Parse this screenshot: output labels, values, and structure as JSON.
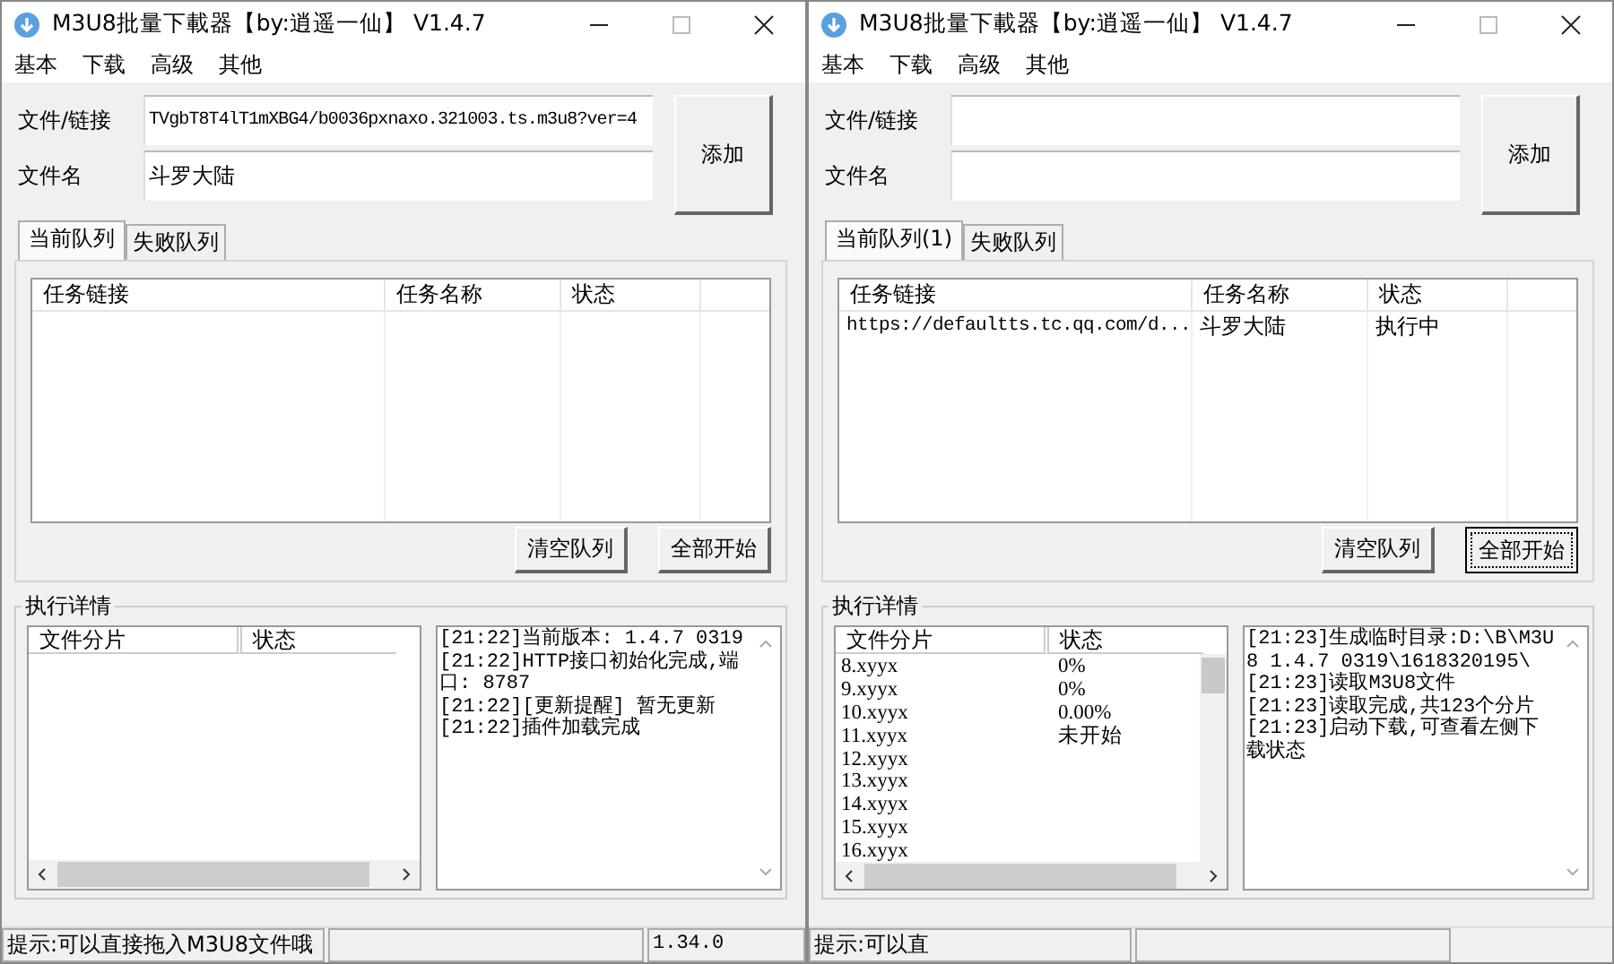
{
  "windows": [
    {
      "title": "M3U8批量下載器【by:逍遥一仙】 V1.4.7",
      "menu": [
        "基本",
        "下载",
        "高级",
        "其他"
      ],
      "fields": [
        {
          "label": "文件/链接",
          "value": "TVgbT8T4lT1mXBG4/b0036pxnaxo.321003.ts.m3u8?ver=4"
        },
        {
          "label": "文件名",
          "value": "斗罗大陆"
        }
      ],
      "add_button": "添加",
      "tabs": [
        {
          "label": "当前队列",
          "selected": true
        },
        {
          "label": "失败队列",
          "selected": false
        }
      ],
      "tasks": {
        "columns": [
          "任务链接",
          "任务名称",
          "状态"
        ]
      },
      "queue_buttons": [
        {
          "label": "清空队列",
          "focused": false
        },
        {
          "label": "全部开始",
          "focused": false
        }
      ],
      "details": {
        "title": "执行详情",
        "columns": [
          "文件分片",
          "状态"
        ],
        "log": [
          "[21:22]当前版本: 1.4.7 0319",
          "[21:22]HTTP接口初始化完成,端口: 8787",
          "[21:22][更新提醒] 暂无更新",
          "[21:22]插件加载完成"
        ]
      },
      "status_bar": {
        "hint": "提示:可以直接拖入M3U8文件哦",
        "version": "1.34.0"
      }
    },
    {
      "title": "M3U8批量下載器【by:逍遥一仙】 V1.4.7",
      "menu": [
        "基本",
        "下载",
        "高级",
        "其他"
      ],
      "fields": [
        {
          "label": "文件/链接"
        },
        {
          "label": "文件名"
        }
      ],
      "add_button": "添加",
      "tabs": [
        {
          "label": "当前队列(1)",
          "selected": true
        },
        {
          "label": "失败队列",
          "selected": false
        }
      ],
      "tasks": {
        "columns": [
          "任务链接",
          "任务名称",
          "状态"
        ],
        "rows": [
          [
            "https://defaultts.tc.qq.com/d...",
            "斗罗大陆",
            "执行中"
          ]
        ]
      },
      "queue_buttons": [
        {
          "label": "清空队列",
          "focused": false
        },
        {
          "label": "全部开始",
          "focused": true
        }
      ],
      "details": {
        "title": "执行详情",
        "columns": [
          "文件分片",
          "状态"
        ],
        "rows": [
          {
            "segment": "8.xyyx",
            "status": "0%"
          },
          {
            "segment": "9.xyyx",
            "status": "0%"
          },
          {
            "segment": "10.xyyx",
            "status": "0.00%"
          },
          {
            "segment": "11.xyyx",
            "status": "未开始"
          },
          {
            "segment": "12.xyyx"
          },
          {
            "segment": "13.xyyx"
          },
          {
            "segment": "14.xyyx"
          },
          {
            "segment": "15.xyyx"
          },
          {
            "segment": "16.xyyx"
          }
        ],
        "log": [
          "[21:23]生成临时目录:D:\\B\\M3U8 1.4.7 0319\\1618320195\\",
          "[21:23]读取M3U8文件",
          "[21:23]读取完成,共123个分片",
          "[21:23]启动下载,可查看左侧下载状态"
        ]
      },
      "status_bar": {
        "hint": "提示:可以直"
      }
    }
  ]
}
